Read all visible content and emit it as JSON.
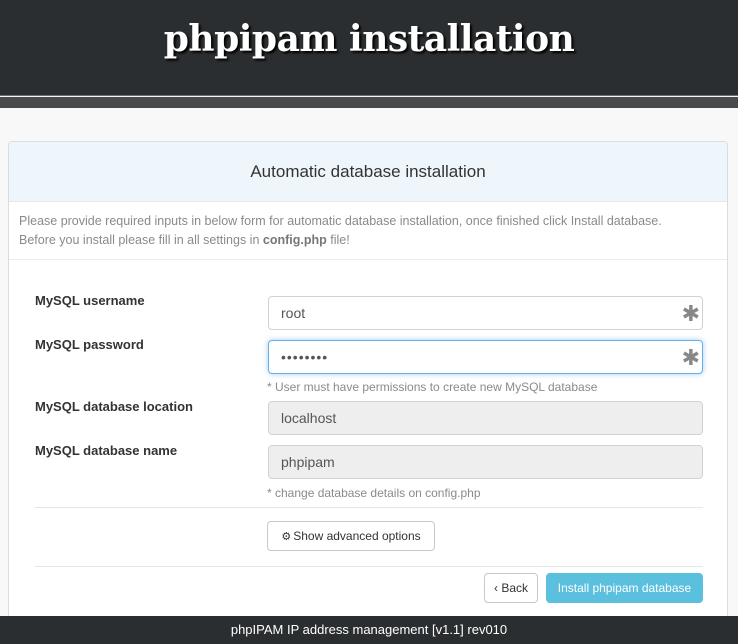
{
  "header": {
    "title": "phpipam installation"
  },
  "panel": {
    "title": "Automatic database installation",
    "info_line1": "Please provide required inputs in below form for automatic database installation, once finished click Install database.",
    "info_line2_prefix": "Before you install please fill in all settings in ",
    "info_line2_file": "config.php",
    "info_line2_suffix": " file!"
  },
  "form": {
    "username_label": "MySQL username",
    "username_value": "root",
    "password_label": "MySQL password",
    "password_value": "••••••••",
    "password_hint": "* User must have permissions to create new MySQL database",
    "location_label": "MySQL database location",
    "location_value": "localhost",
    "dbname_label": "MySQL database name",
    "dbname_value": "phpipam",
    "db_hint": "* change database details on config.php",
    "required_mark": "✱"
  },
  "buttons": {
    "advanced_label": "Show advanced options",
    "advanced_icon": "gears-icon",
    "back_label": "Back",
    "back_icon": "chevron-left-icon",
    "install_label": "Install phpipam database"
  },
  "colors": {
    "header_bg": "#2b2e30",
    "panel_heading_bg": "#eef6fb",
    "primary": "#5bc0de",
    "focus": "#66afe9"
  },
  "footer": {
    "text": "phpIPAM IP address management [v1.1] rev010"
  }
}
